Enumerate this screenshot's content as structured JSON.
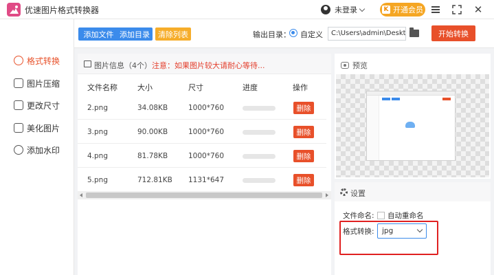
{
  "app": {
    "title": "优速图片格式转换器"
  },
  "titlebar": {
    "user_label": "未登录",
    "vip_label": "开通会员",
    "vip_badge": "K",
    "close_glyph": "✕"
  },
  "sidebar": {
    "items": [
      {
        "label": "格式转换",
        "active": true
      },
      {
        "label": "图片压缩",
        "active": false
      },
      {
        "label": "更改尺寸",
        "active": false
      },
      {
        "label": "美化图片",
        "active": false
      },
      {
        "label": "添加水印",
        "active": false
      }
    ]
  },
  "toolbar": {
    "add_file": "添加文件",
    "add_dir": "添加目录",
    "clear_list": "清除列表",
    "output_label": "输出目录：",
    "custom_label": "自定义",
    "path_value": "C:\\Users\\admin\\Deskto",
    "start_label": "开始转换"
  },
  "file_panel": {
    "info_label": "图片信息（4个）",
    "note": "注意：如果图片较大请耐心等待...",
    "columns": [
      "文件名称",
      "大小",
      "尺寸",
      "进度",
      "操作"
    ],
    "rows": [
      {
        "name": "2.png",
        "size": "34.08KB",
        "dims": "1000*760",
        "progress": 0,
        "action": "删除"
      },
      {
        "name": "3.png",
        "size": "90.00KB",
        "dims": "1000*760",
        "progress": 0,
        "action": "删除"
      },
      {
        "name": "4.png",
        "size": "81.78KB",
        "dims": "1000*760",
        "progress": 0,
        "action": "删除"
      },
      {
        "name": "5.png",
        "size": "712.81KB",
        "dims": "1131*647",
        "progress": 0,
        "action": "删除"
      }
    ]
  },
  "preview": {
    "title": "预览"
  },
  "settings": {
    "title": "设置",
    "filename_label": "文件命名:",
    "auto_rename_label": "自动重命名",
    "format_label": "格式转换:",
    "format_value": "jpg"
  },
  "colors": {
    "accent_blue": "#3b8beb",
    "accent_orange": "#e8502a",
    "clear_yellow": "#f6ad2a",
    "highlight_red": "#e02020"
  }
}
